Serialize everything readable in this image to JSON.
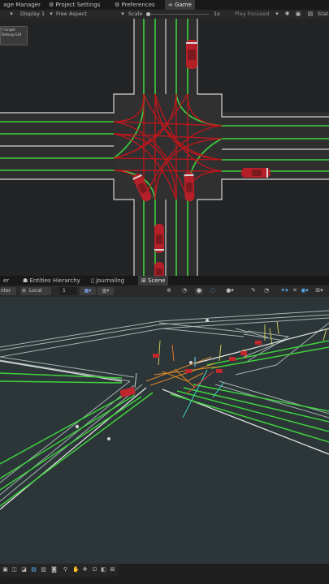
{
  "game_tabs": {
    "package_manager": "age Manager",
    "project_settings": "Project Settings",
    "preferences": "Preferences",
    "game": "Game"
  },
  "game_toolbar": {
    "display": "Display 1",
    "aspect": "Free Aspect",
    "scale_label": "Scale",
    "scale_value": "1x",
    "play_mode": "Play Focused",
    "stats": "Stat"
  },
  "overlay": {
    "line1": "t Graph",
    "line2": "Debug GUI"
  },
  "scene_tabs": {
    "hierarchy": "er",
    "entities_hierarchy": "Entities Hierarchy",
    "journaling": "Journaling",
    "scene": "Scene"
  },
  "scene_toolbar": {
    "pivot": "nter",
    "space": "Local",
    "grid_value": "1"
  },
  "colors": {
    "lane": "#3ed23e",
    "road_edge": "#d2d2d2",
    "intersection_path": "#c0161b",
    "car": "#b51f27",
    "scene_bg": "#2c3537"
  }
}
